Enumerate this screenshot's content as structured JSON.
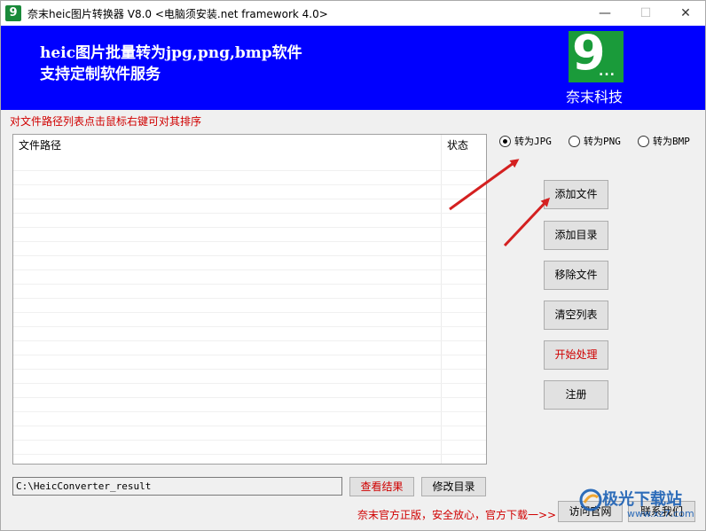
{
  "titlebar": {
    "title": "奈末heic图片转换器 V8.0 <电脑须安装.net framework 4.0>",
    "app_icon_glyph": "9",
    "minimize_glyph": "—",
    "maximize_glyph": "☐",
    "close_glyph": "✕"
  },
  "banner": {
    "line1": "heic图片批量转为jpg,png,bmp软件",
    "line2": "支持定制软件服务",
    "logo_glyph": "9",
    "logo_dots": "...",
    "logo_caption": "奈末科技",
    "bg_color": "#0000ff"
  },
  "hint": "对文件路径列表点击鼠标右键可对其排序",
  "file_list": {
    "columns": [
      "文件路径",
      "状态"
    ],
    "rows": []
  },
  "formats": {
    "jpg_label": "转为JPG",
    "png_label": "转为PNG",
    "bmp_label": "转为BMP",
    "selected": "JPG"
  },
  "buttons": {
    "add_file": "添加文件",
    "add_dir": "添加目录",
    "remove_file": "移除文件",
    "clear_list": "清空列表",
    "start": "开始处理",
    "register": "注册"
  },
  "output": {
    "path": "C:\\HeicConverter_result",
    "view_result": "查看结果",
    "change_dir": "修改目录"
  },
  "footer": {
    "note": "奈末官方正版，安全放心，官方下载一>>",
    "visit_site": "访问官网",
    "contact": "联系我们"
  },
  "watermark": {
    "text": "极光下载站",
    "sub": "www.xz7.com"
  },
  "colors": {
    "accent_red": "#d00000",
    "arrow_red": "#d42020",
    "logo_green": "#1a9b3a"
  }
}
